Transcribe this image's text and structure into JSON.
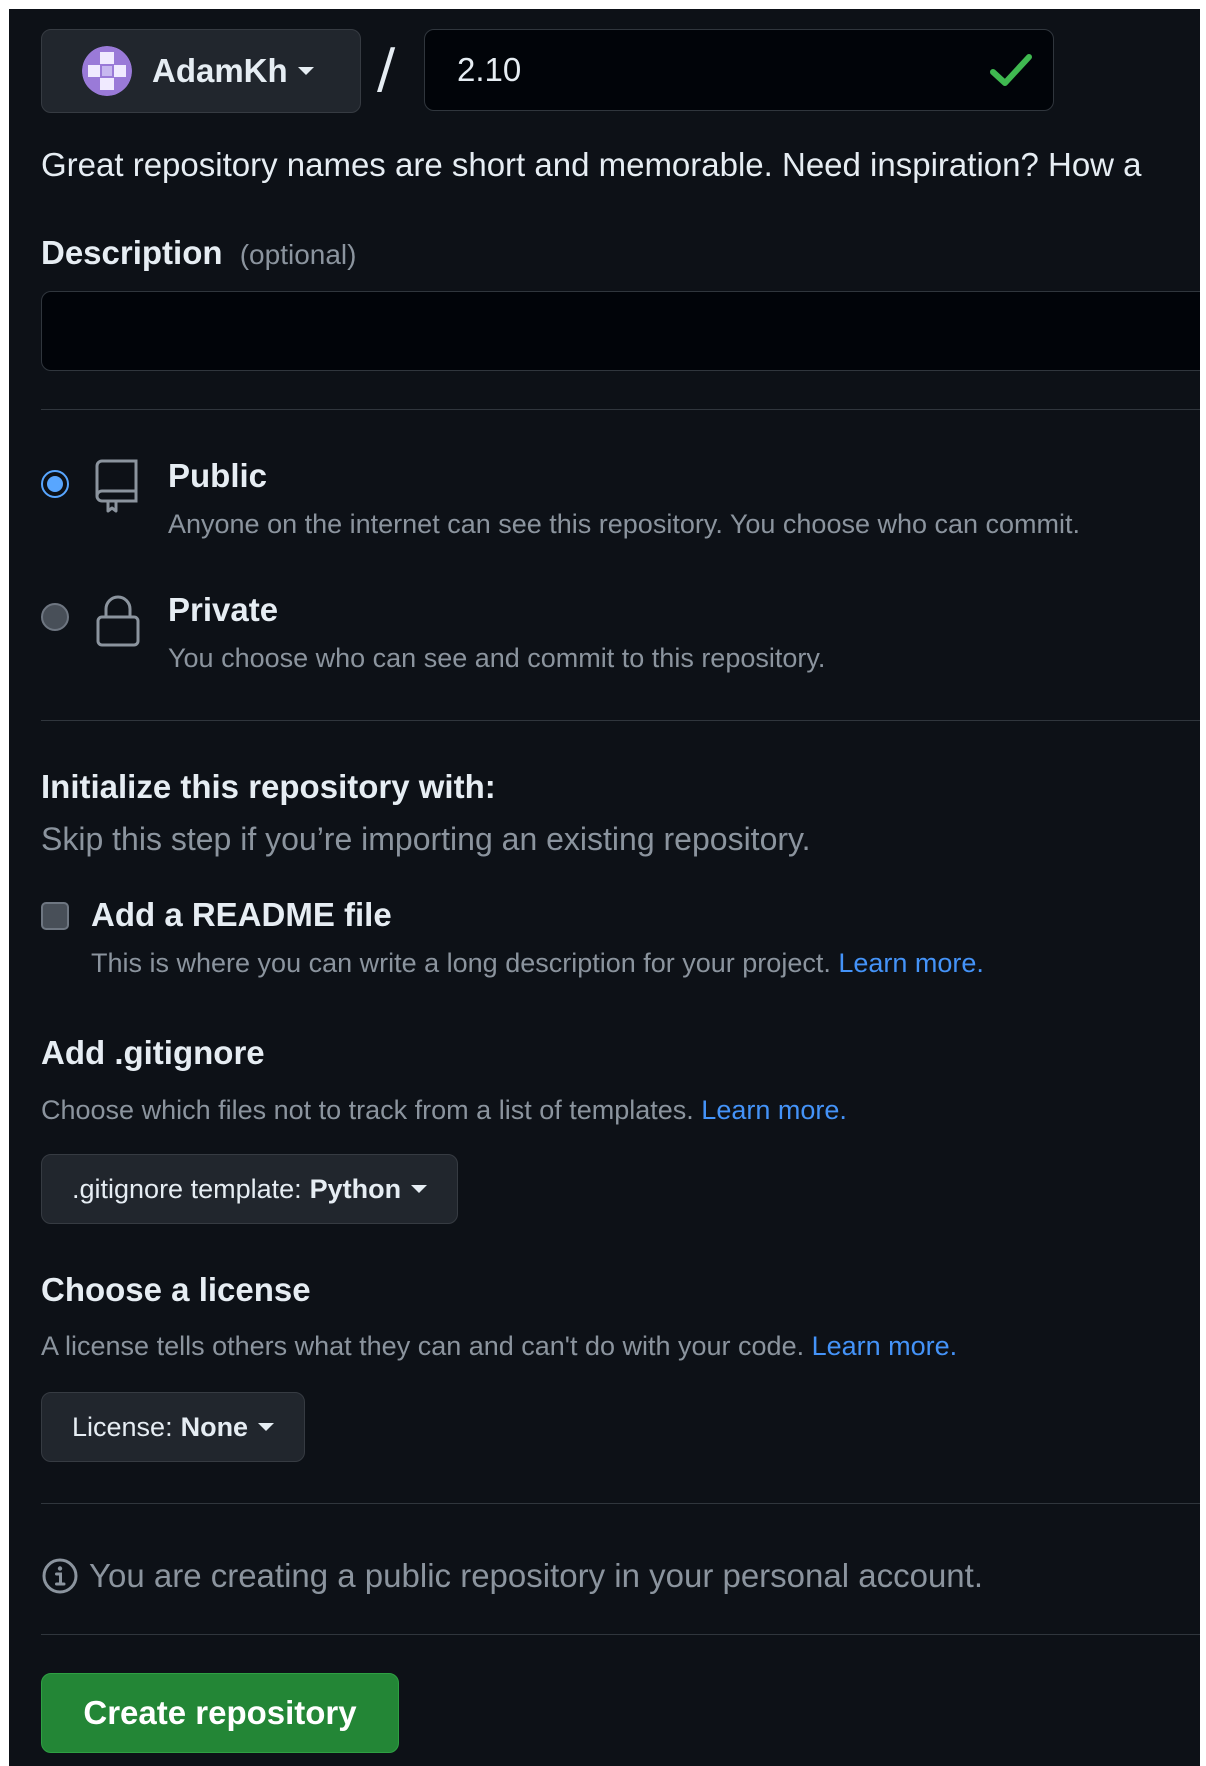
{
  "owner": {
    "name": "AdamKh"
  },
  "repo_name": {
    "value": "2.10",
    "separator": "/"
  },
  "hint": "Great repository names are short and memorable. Need inspiration? How a",
  "description": {
    "label": "Description",
    "optional": "(optional)",
    "value": ""
  },
  "visibility": {
    "public": {
      "title": "Public",
      "desc": "Anyone on the internet can see this repository. You choose who can commit.",
      "selected": true
    },
    "private": {
      "title": "Private",
      "desc": "You choose who can see and commit to this repository.",
      "selected": false
    }
  },
  "initialize": {
    "title": "Initialize this repository with:",
    "subtitle": "Skip this step if you’re importing an existing repository.",
    "readme": {
      "label": "Add a README file",
      "desc": "This is where you can write a long description for your project.",
      "link": "Learn more.",
      "checked": false
    }
  },
  "gitignore": {
    "title": "Add .gitignore",
    "desc": "Choose which files not to track from a list of templates.",
    "link": "Learn more.",
    "button_prefix": ".gitignore template:",
    "button_value": "Python"
  },
  "license": {
    "title": "Choose a license",
    "desc": "A license tells others what they can and can't do with your code.",
    "link": "Learn more.",
    "button_prefix": "License:",
    "button_value": "None"
  },
  "info": "You are creating a public repository in your personal account.",
  "create_button": "Create repository",
  "colors": {
    "background": "#0d1117",
    "accent_blue": "#4493f8",
    "create_green": "#238636",
    "check_green": "#3fb950"
  }
}
